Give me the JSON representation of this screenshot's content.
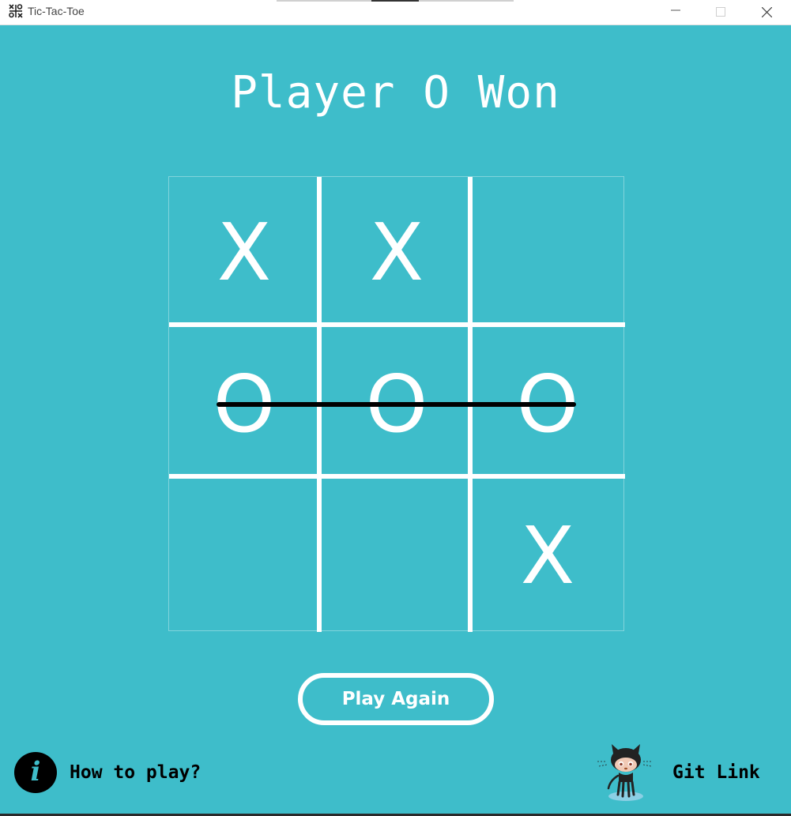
{
  "window": {
    "title": "Tic-Tac-Toe"
  },
  "game": {
    "status": "Player O Won",
    "board": [
      [
        "X",
        "X",
        ""
      ],
      [
        "O",
        "O",
        "O"
      ],
      [
        "",
        "",
        "X"
      ]
    ],
    "winning_line": "row-2",
    "play_again_label": "Play Again"
  },
  "footer": {
    "how_to_play_label": "How to play?",
    "git_link_label": "Git Link",
    "info_icon": "i"
  },
  "colors": {
    "background": "#3ebdca",
    "marks": "#ffffff",
    "strike": "#000000"
  }
}
